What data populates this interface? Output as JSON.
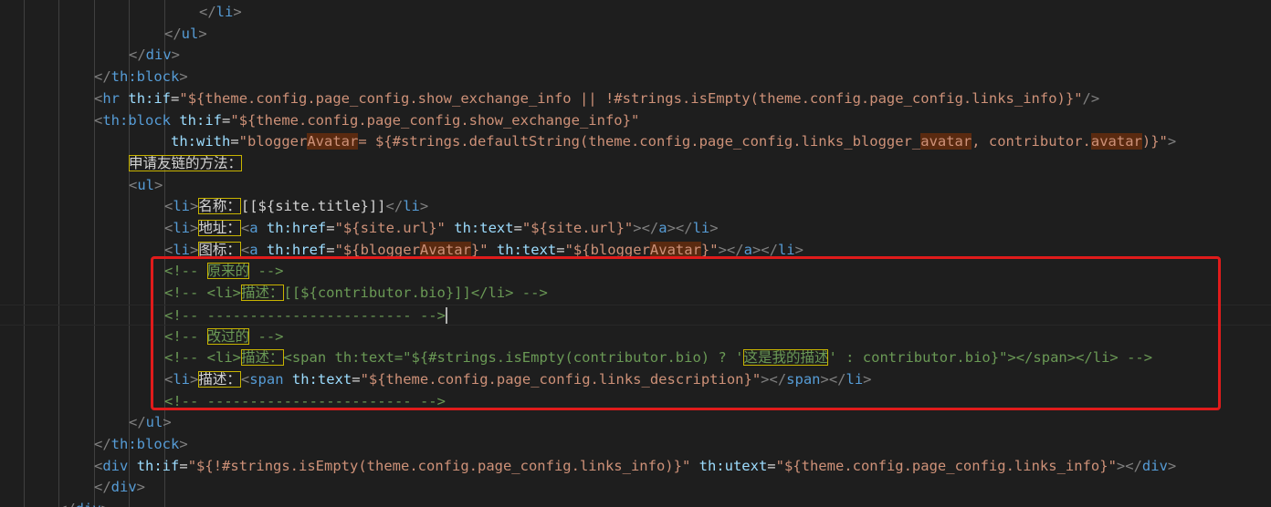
{
  "lines": [
    {
      "indent": 7,
      "tokens": [
        [
          "brk",
          "</"
        ],
        [
          "tag",
          "li"
        ],
        [
          "brk",
          ">"
        ]
      ]
    },
    {
      "indent": 6,
      "tokens": [
        [
          "brk",
          "</"
        ],
        [
          "tag",
          "ul"
        ],
        [
          "brk",
          ">"
        ]
      ]
    },
    {
      "indent": 5,
      "tokens": [
        [
          "brk",
          "</"
        ],
        [
          "tag",
          "div"
        ],
        [
          "brk",
          ">"
        ]
      ]
    },
    {
      "indent": 4,
      "tokens": [
        [
          "brk",
          "</"
        ],
        [
          "tag",
          "th:block"
        ],
        [
          "brk",
          ">"
        ]
      ]
    },
    {
      "indent": 4,
      "tokens": [
        [
          "brk",
          "<"
        ],
        [
          "tag",
          "hr"
        ],
        [
          "txt",
          " "
        ],
        [
          "attr",
          "th:if"
        ],
        [
          "txt",
          "="
        ],
        [
          "str",
          "\"${theme.config.page_config.show_exchange_info || !#strings.isEmpty(theme.config.page_config.links_info)}\""
        ],
        [
          "brk",
          "/>"
        ]
      ]
    },
    {
      "indent": 4,
      "tokens": [
        [
          "brk",
          "<"
        ],
        [
          "tag",
          "th:block"
        ],
        [
          "txt",
          " "
        ],
        [
          "attr",
          "th:if"
        ],
        [
          "txt",
          "="
        ],
        [
          "str",
          "\"${theme.config.page_config.show_exchange_info}\""
        ]
      ]
    },
    {
      "indent": 4,
      "tokens": [
        [
          "txt",
          "         "
        ],
        [
          "attr",
          "th:with"
        ],
        [
          "txt",
          "="
        ],
        [
          "str",
          "\"bloggerAvatar= ${#strings.defaultString(theme.config.page_config.links_blogger_avatar, contributor.avatar)}\""
        ],
        [
          "brk",
          ">"
        ]
      ]
    },
    {
      "indent": 5,
      "tokens": [
        [
          "txt",
          "申请友链的方法：",
          "box"
        ]
      ]
    },
    {
      "indent": 5,
      "tokens": [
        [
          "brk",
          "<"
        ],
        [
          "tag",
          "ul"
        ],
        [
          "brk",
          ">"
        ]
      ]
    },
    {
      "indent": 6,
      "tokens": [
        [
          "brk",
          "<"
        ],
        [
          "tag",
          "li"
        ],
        [
          "brk",
          ">"
        ],
        [
          "txt",
          "名称：",
          "box"
        ],
        [
          "txt",
          "[[${site.title}]]"
        ],
        [
          "brk",
          "</"
        ],
        [
          "tag",
          "li"
        ],
        [
          "brk",
          ">"
        ]
      ]
    },
    {
      "indent": 6,
      "tokens": [
        [
          "brk",
          "<"
        ],
        [
          "tag",
          "li"
        ],
        [
          "brk",
          ">"
        ],
        [
          "txt",
          "地址：",
          "box"
        ],
        [
          "brk",
          "<"
        ],
        [
          "tag",
          "a"
        ],
        [
          "txt",
          " "
        ],
        [
          "attr",
          "th:href"
        ],
        [
          "txt",
          "="
        ],
        [
          "str",
          "\"${site.url}\""
        ],
        [
          "txt",
          " "
        ],
        [
          "attr",
          "th:text"
        ],
        [
          "txt",
          "="
        ],
        [
          "str",
          "\"${site.url}\""
        ],
        [
          "brk",
          "></"
        ],
        [
          "tag",
          "a"
        ],
        [
          "brk",
          "></"
        ],
        [
          "tag",
          "li"
        ],
        [
          "brk",
          ">"
        ]
      ]
    },
    {
      "indent": 6,
      "tokens": [
        [
          "brk",
          "<"
        ],
        [
          "tag",
          "li"
        ],
        [
          "brk",
          ">"
        ],
        [
          "txt",
          "图标：",
          "box"
        ],
        [
          "brk",
          "<"
        ],
        [
          "tag",
          "a"
        ],
        [
          "txt",
          " "
        ],
        [
          "attr",
          "th:href"
        ],
        [
          "txt",
          "="
        ],
        [
          "str",
          "\"${bloggerAvatar}\""
        ],
        [
          "txt",
          " "
        ],
        [
          "attr",
          "th:text"
        ],
        [
          "txt",
          "="
        ],
        [
          "str",
          "\"${bloggerAvatar}\""
        ],
        [
          "brk",
          "></"
        ],
        [
          "tag",
          "a"
        ],
        [
          "brk",
          "></"
        ],
        [
          "tag",
          "li"
        ],
        [
          "brk",
          ">"
        ]
      ]
    },
    {
      "indent": 6,
      "tokens": [
        [
          "com",
          "<!-- "
        ],
        [
          "com",
          "原来的",
          "box"
        ],
        [
          "com",
          " -->"
        ]
      ]
    },
    {
      "indent": 6,
      "tokens": [
        [
          "com",
          "<!-- <li>"
        ],
        [
          "com",
          "描述：",
          "box"
        ],
        [
          "com",
          "[[${contributor.bio}]]</li> -->"
        ]
      ]
    },
    {
      "indent": 6,
      "tokens": [
        [
          "com",
          "<!-- ------------------------ -->"
        ],
        [
          "caret",
          ""
        ]
      ]
    },
    {
      "indent": 6,
      "tokens": [
        [
          "com",
          "<!-- "
        ],
        [
          "com",
          "改过的",
          "box"
        ],
        [
          "com",
          " -->"
        ]
      ]
    },
    {
      "indent": 6,
      "tokens": [
        [
          "com",
          "<!-- <li>"
        ],
        [
          "com",
          "描述：",
          "box"
        ],
        [
          "com",
          "<span th:text=\"${#strings.isEmpty(contributor.bio) ? '"
        ],
        [
          "com",
          "这是我的描述",
          "box"
        ],
        [
          "com",
          "' : contributor.bio}\"></span></li> -->"
        ]
      ]
    },
    {
      "indent": 6,
      "tokens": [
        [
          "brk",
          "<"
        ],
        [
          "tag",
          "li"
        ],
        [
          "brk",
          ">"
        ],
        [
          "txt",
          "描述：",
          "box"
        ],
        [
          "brk",
          "<"
        ],
        [
          "tag",
          "span"
        ],
        [
          "txt",
          " "
        ],
        [
          "attr",
          "th:text"
        ],
        [
          "txt",
          "="
        ],
        [
          "str",
          "\"${theme.config.page_config.links_description}\""
        ],
        [
          "brk",
          "></"
        ],
        [
          "tag",
          "span"
        ],
        [
          "brk",
          "></"
        ],
        [
          "tag",
          "li"
        ],
        [
          "brk",
          ">"
        ]
      ]
    },
    {
      "indent": 6,
      "tokens": [
        [
          "com",
          "<!-- ------------------------ -->"
        ]
      ]
    },
    {
      "indent": 5,
      "tokens": [
        [
          "brk",
          "</"
        ],
        [
          "tag",
          "ul"
        ],
        [
          "brk",
          ">"
        ]
      ]
    },
    {
      "indent": 4,
      "tokens": [
        [
          "brk",
          "</"
        ],
        [
          "tag",
          "th:block"
        ],
        [
          "brk",
          ">"
        ]
      ]
    },
    {
      "indent": 4,
      "tokens": [
        [
          "brk",
          "<"
        ],
        [
          "tag",
          "div"
        ],
        [
          "txt",
          " "
        ],
        [
          "attr",
          "th:if"
        ],
        [
          "txt",
          "="
        ],
        [
          "str",
          "\"${!#strings.isEmpty(theme.config.page_config.links_info)}\""
        ],
        [
          "txt",
          " "
        ],
        [
          "attr",
          "th:utext"
        ],
        [
          "txt",
          "="
        ],
        [
          "str",
          "\"${theme.config.page_config.links_info}\""
        ],
        [
          "brk",
          "></"
        ],
        [
          "tag",
          "div"
        ],
        [
          "brk",
          ">"
        ]
      ]
    },
    {
      "indent": 3,
      "tokens": [
        [
          "brk",
          "</"
        ],
        [
          "tag",
          "div"
        ],
        [
          "brk",
          ">"
        ]
      ]
    },
    {
      "indent": 2,
      "tokens": [
        [
          "brk",
          "</"
        ],
        [
          "tag",
          "div"
        ],
        [
          "brk",
          ">"
        ]
      ]
    }
  ],
  "highlight_words": [
    "Avatar",
    "avatar"
  ],
  "colors": {
    "background": "#1e1e1e",
    "tag": "#569cd6",
    "attribute": "#9cdcfe",
    "string": "#ce9178",
    "comment": "#6a9955",
    "annotation_box": "#e01b1b"
  }
}
